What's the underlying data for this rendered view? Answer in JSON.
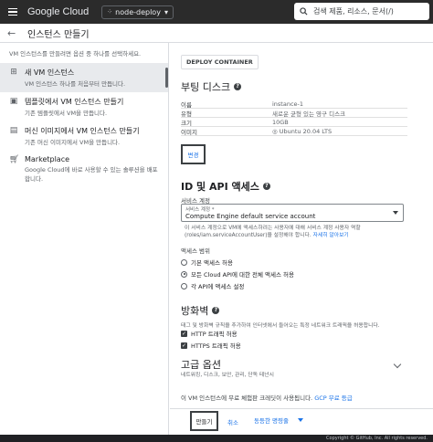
{
  "topbar": {
    "logo": "Google Cloud",
    "project": "node-deploy",
    "search_placeholder": "검색  제품, 리소스, 문서(/)"
  },
  "header": {
    "title": "인스턴스 만들기"
  },
  "sidebar": {
    "intro": "VM 인스턴스를 만들려면 옵션 중 하나를 선택하세요.",
    "options": [
      {
        "icon": "add-icon",
        "title": "새 VM 인스턴스",
        "desc": "VM 인스턴스 하나를 처음부터 만듭니다."
      },
      {
        "icon": "template-icon",
        "title": "템플릿에서 VM 인스턴스 만들기",
        "desc": "기존 템플릿에서 VM을 만듭니다."
      },
      {
        "icon": "machine-image-icon",
        "title": "머신 이미지에서 VM 인스턴스 만들기",
        "desc": "기존 머신 이미지에서 VM을 만듭니다."
      },
      {
        "icon": "marketplace-icon",
        "title": "Marketplace",
        "desc": "Google Cloud에 바로 사용할 수 있는 솔루션을 배포합니다."
      }
    ]
  },
  "main": {
    "deploy_container": "DEPLOY CONTAINER",
    "boot_disk": {
      "heading": "부팅 디스크",
      "rows": [
        {
          "k": "이름",
          "v": "instance-1"
        },
        {
          "k": "유형",
          "v": "새로운 균형 있는 영구 디스크"
        },
        {
          "k": "크기",
          "v": "10GB"
        },
        {
          "k": "이미지",
          "v": "Ubuntu 20.04 LTS"
        }
      ],
      "change": "변경"
    },
    "id_api": {
      "heading": "ID 및 API 액세스",
      "sa_label": "서비스 계정",
      "sa_small": "서비스 계정 *",
      "sa_value": "Compute Engine default service account",
      "sa_help": "이 서비스 계정으로 VM에 액세스하려는 사용자에 대해 서비스 계정 사용자 역할(roles/iam.serviceAccountUser)을 설정해야 합니다.",
      "sa_help_link": "자세히 알아보기",
      "scope_label": "액세스 범위",
      "scopes": [
        "기본 액세스 허용",
        "모든 Cloud API에 대한 전체 액세스 허용",
        "각 API에 액세스 설정"
      ],
      "scope_selected": 1
    },
    "firewall": {
      "heading": "방화벽",
      "desc": "태그 및 방화벽 규칙을 추가하여 인터넷에서 들어오는 특정 네트워크 트래픽을 허용합니다.",
      "http": "HTTP 트래픽 허용",
      "https": "HTTPS 트래픽 허용"
    },
    "advanced": {
      "heading": "고급 옵션",
      "desc": "네트워킹, 디스크, 보안, 관리, 단독 테넌시"
    },
    "free_note": "이 VM 인스턴스에 무료 체험판 크레딧이 사용됩니다.",
    "free_link": "GCP 무료 등급"
  },
  "bottom": {
    "create": "만들기",
    "cancel": "취소",
    "equivalent": "동등한 명령줄"
  },
  "footer": "Copyright © GitHub, Inc. All rights reserved."
}
